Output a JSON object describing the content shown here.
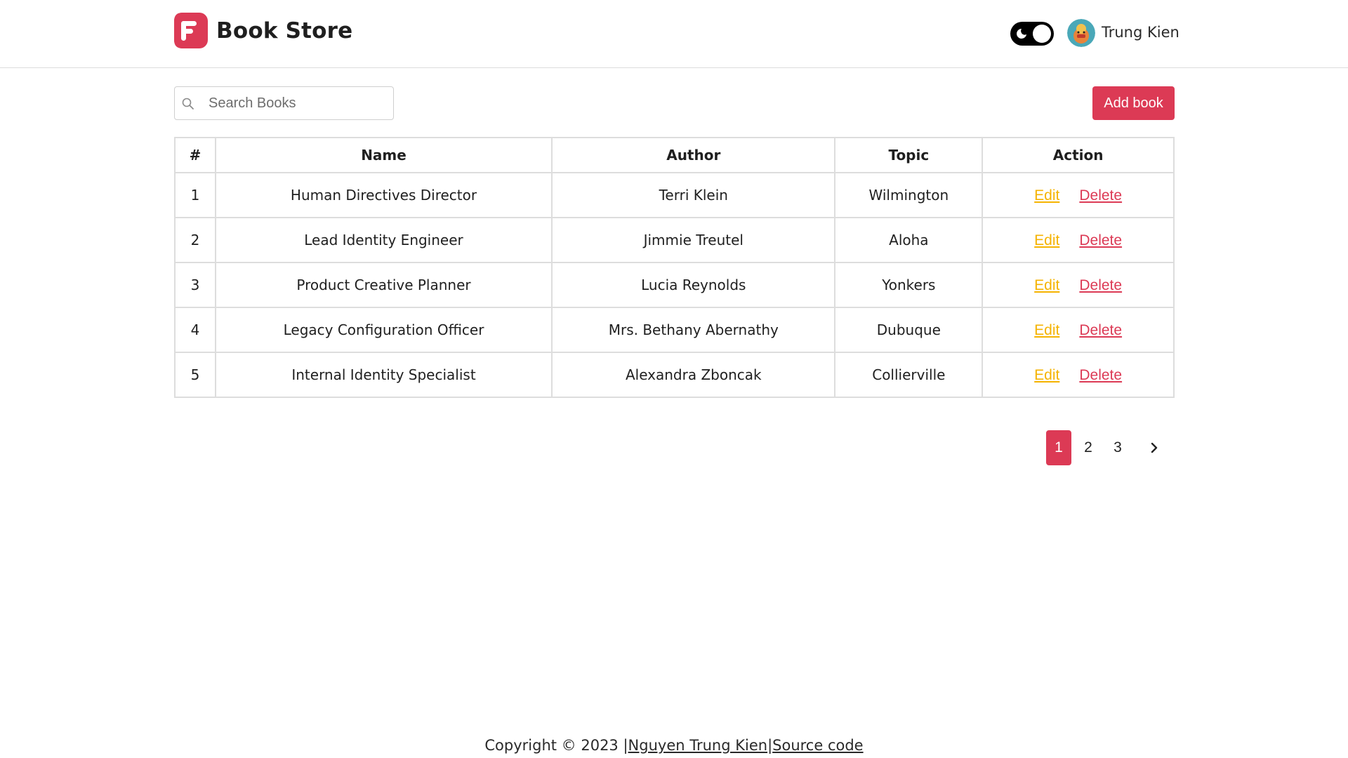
{
  "header": {
    "brand": "Book Store",
    "username": "Trung Kien",
    "accent_color": "#dc3a55"
  },
  "toolbar": {
    "search_placeholder": "Search Books",
    "search_value": "",
    "add_button_label": "Add book"
  },
  "table": {
    "headers": [
      "#",
      "Name",
      "Author",
      "Topic",
      "Action"
    ],
    "rows": [
      {
        "num": "1",
        "name": "Human Directives Director",
        "author": "Terri Klein",
        "topic": "Wilmington"
      },
      {
        "num": "2",
        "name": "Lead Identity Engineer",
        "author": "Jimmie Treutel",
        "topic": "Aloha"
      },
      {
        "num": "3",
        "name": "Product Creative Planner",
        "author": "Lucia Reynolds",
        "topic": "Yonkers"
      },
      {
        "num": "4",
        "name": "Legacy Configuration Officer",
        "author": "Mrs. Bethany Abernathy",
        "topic": "Dubuque"
      },
      {
        "num": "5",
        "name": "Internal Identity Specialist",
        "author": "Alexandra Zboncak",
        "topic": "Collierville"
      }
    ],
    "edit_label": "Edit",
    "delete_label": "Delete"
  },
  "pagination": {
    "pages": [
      "1",
      "2",
      "3"
    ],
    "current": "1"
  },
  "footer": {
    "copyright": "Copyright © 2023 |",
    "author_link": "Nguyen Trung Kien",
    "separator": "|",
    "source_link": "Source code"
  }
}
